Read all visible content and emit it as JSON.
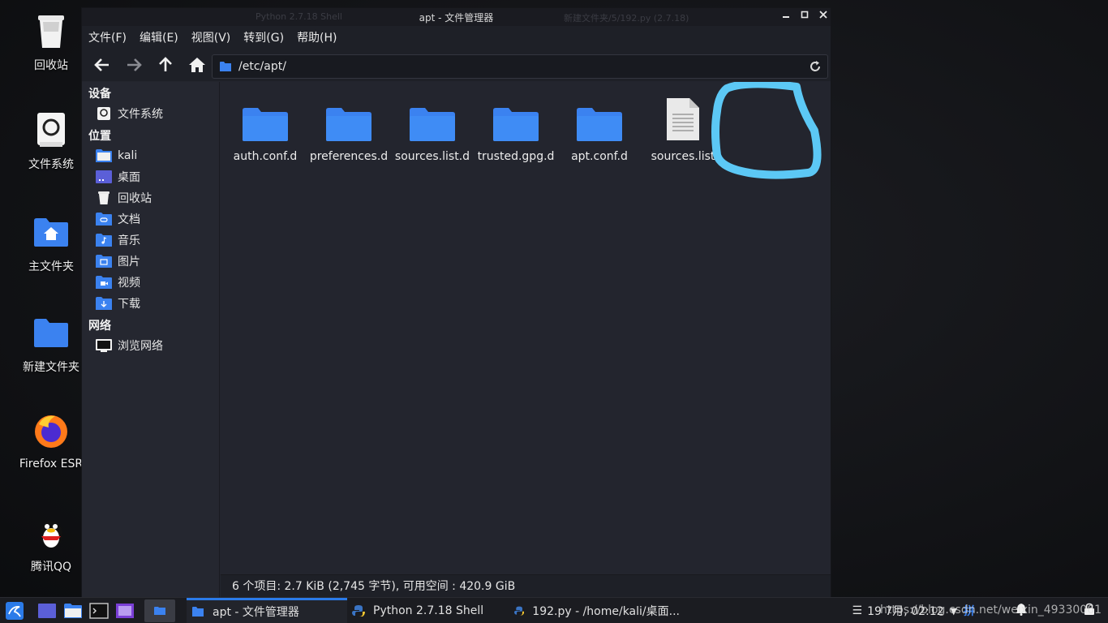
{
  "desktop": {
    "icons": [
      {
        "label": "回收站",
        "icon": "trash-icon"
      },
      {
        "label": "文件系统",
        "icon": "filesystem-icon"
      },
      {
        "label": "主文件夹",
        "icon": "home-folder-icon"
      },
      {
        "label": "新建文件夹",
        "icon": "folder-icon"
      },
      {
        "label": "Firefox ESR",
        "icon": "firefox-icon"
      },
      {
        "label": "腾讯QQ",
        "icon": "qq-icon"
      }
    ]
  },
  "window": {
    "title": "apt - 文件管理器",
    "ghost_left": "Python 2.7.18 Shell",
    "ghost_right": "新建文件夹/5/192.py (2.7.18)",
    "menu": [
      "文件(F)",
      "编辑(E)",
      "视图(V)",
      "转到(G)",
      "帮助(H)"
    ],
    "path": "/etc/apt/"
  },
  "sidebar": {
    "devices_header": "设备",
    "devices": [
      {
        "label": "文件系统",
        "icon": "drive-icon"
      }
    ],
    "places_header": "位置",
    "places": [
      {
        "label": "kali",
        "icon": "home-icon"
      },
      {
        "label": "桌面",
        "icon": "desktop-icon"
      },
      {
        "label": "回收站",
        "icon": "trash-icon"
      },
      {
        "label": "文档",
        "icon": "documents-icon"
      },
      {
        "label": "音乐",
        "icon": "music-icon"
      },
      {
        "label": "图片",
        "icon": "pictures-icon"
      },
      {
        "label": "视频",
        "icon": "videos-icon"
      },
      {
        "label": "下载",
        "icon": "downloads-icon"
      }
    ],
    "network_header": "网络",
    "network": [
      {
        "label": "浏览网络",
        "icon": "network-icon"
      }
    ]
  },
  "files": [
    {
      "name": "auth.conf.d",
      "type": "folder"
    },
    {
      "name": "preferences.d",
      "type": "folder"
    },
    {
      "name": "sources.list.d",
      "type": "folder"
    },
    {
      "name": "trusted.gpg.d",
      "type": "folder"
    },
    {
      "name": "apt.conf.d",
      "type": "folder"
    },
    {
      "name": "sources.list",
      "type": "text-file",
      "highlighted": true
    }
  ],
  "status": "6 个项目: 2.7 KiB (2,745 字节), 可用空间 : 420.9 GiB",
  "taskbar": {
    "tasks": [
      {
        "label": "apt - 文件管理器",
        "active": true
      },
      {
        "label": "Python 2.7.18 Shell",
        "active": false
      },
      {
        "label": "192.py - /home/kali/桌面...",
        "active": false
      }
    ],
    "clock": "19 7月, 02:12",
    "ime": "拼",
    "watermark": "https://blog.csdn.net/weixin_49330061"
  },
  "colors": {
    "accent": "#2b7be9",
    "folder": "#3b82f0",
    "highlight_stroke": "#5cc8f5",
    "window_bg": "#23252e"
  }
}
